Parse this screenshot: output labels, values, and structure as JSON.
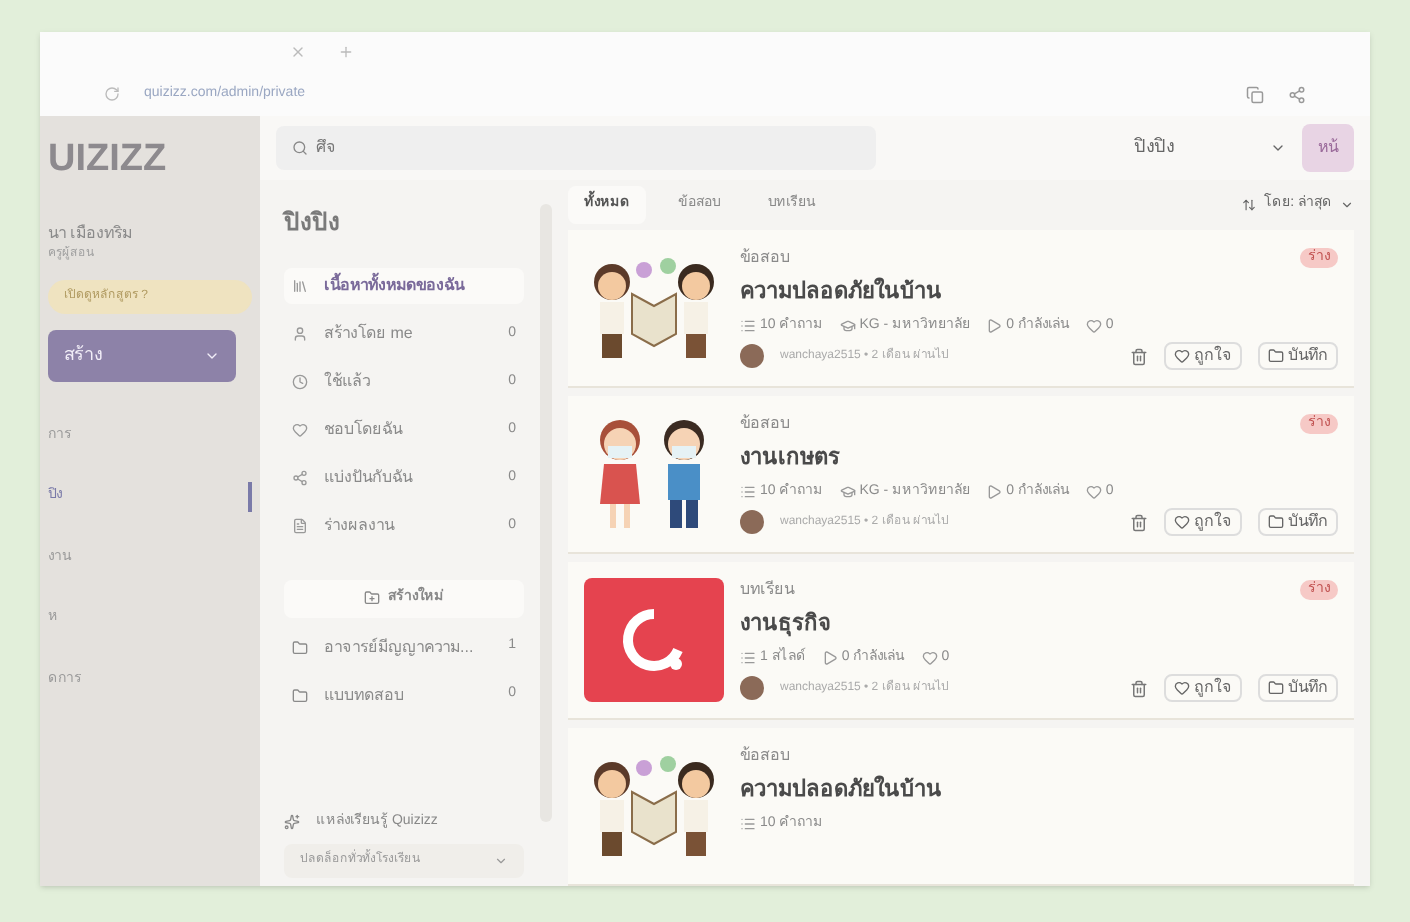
{
  "browser": {
    "url": "quizizz.com/admin/private"
  },
  "sidebar": {
    "logo": "UIZIZZ",
    "user_name": "นา เมืองทริม",
    "user_role": "ครูผู้สอน",
    "upgrade": "เปิดดูหลักสูตร ?",
    "create_button": "สร้าง",
    "items": [
      {
        "label": "การ",
        "selected": false
      },
      {
        "label": "ปิง",
        "selected": true
      },
      {
        "label": "งาน",
        "selected": false
      },
      {
        "label": "ห",
        "selected": false
      },
      {
        "label": "ดการ",
        "selected": false
      }
    ]
  },
  "search": {
    "value": "ศึจ"
  },
  "header": {
    "account": "ปิงปิง",
    "button": "หน้"
  },
  "library": {
    "title": "ปิงปิง",
    "filters": [
      {
        "label": "เนื้อหาทั้งหมดของฉัน",
        "selected": true
      },
      {
        "label": "สร้างโดย me",
        "count": "0",
        "selected": false
      },
      {
        "label": "ใช้แล้ว",
        "count": "0",
        "selected": false
      },
      {
        "label": "ชอบโดยฉัน",
        "count": "0",
        "selected": false
      },
      {
        "label": "แบ่งปันกับฉัน",
        "count": "0",
        "selected": false
      },
      {
        "label": "ร่างผลงาน",
        "count": "0",
        "selected": false
      }
    ],
    "new_folder": "สร้างใหม่",
    "folders": [
      {
        "label": "อาจารย์มีญญาความ...",
        "count": "1"
      },
      {
        "label": "แบบทดสอบ",
        "count": "0"
      }
    ],
    "resources": "แหล่งเรียนรู้ Quizizz",
    "unlock": "ปลดล็อกทั่วทั้งโรงเรียน"
  },
  "content": {
    "tabs": [
      {
        "label": "ทั้งหมด",
        "selected": true
      },
      {
        "label": "ข้อสอบ",
        "selected": false
      },
      {
        "label": "บทเรียน",
        "selected": false
      }
    ],
    "sort": "โดย: ล่าสุด",
    "cards": [
      {
        "kind": "kids",
        "type": "ข้อสอบ",
        "title": "ความปลอดภัยในบ้าน",
        "meta": [
          "10 คำถาม",
          "KG - มหาวิทยาลัย",
          "0 กำลังเล่น",
          "0"
        ],
        "author": "wanchaya2515 • 2 เดือน ผ่านไป",
        "badge": "ร่าง",
        "like": "ถูกใจ",
        "save": "บันทึก"
      },
      {
        "kind": "masks",
        "type": "ข้อสอบ",
        "title": "งานเกษตร",
        "meta": [
          "10 คำถาม",
          "KG - มหาวิทยาลัย",
          "0 กำลังเล่น",
          "0"
        ],
        "author": "wanchaya2515 • 2 เดือน ผ่านไป",
        "badge": "ร่าง",
        "like": "ถูกใจ",
        "save": "บันทึก"
      },
      {
        "kind": "logo",
        "type": "บทเรียน",
        "title": "งานธุรกิจ",
        "meta": [
          "1 สไลด์",
          "0 กำลังเล่น",
          "0"
        ],
        "author": "wanchaya2515 • 2 เดือน ผ่านไป",
        "badge": "ร่าง",
        "like": "ถูกใจ",
        "save": "บันทึก"
      },
      {
        "kind": "kids",
        "type": "ข้อสอบ",
        "title": "ความปลอดภัยในบ้าน",
        "meta": [
          "10 คำถาม"
        ]
      }
    ]
  }
}
